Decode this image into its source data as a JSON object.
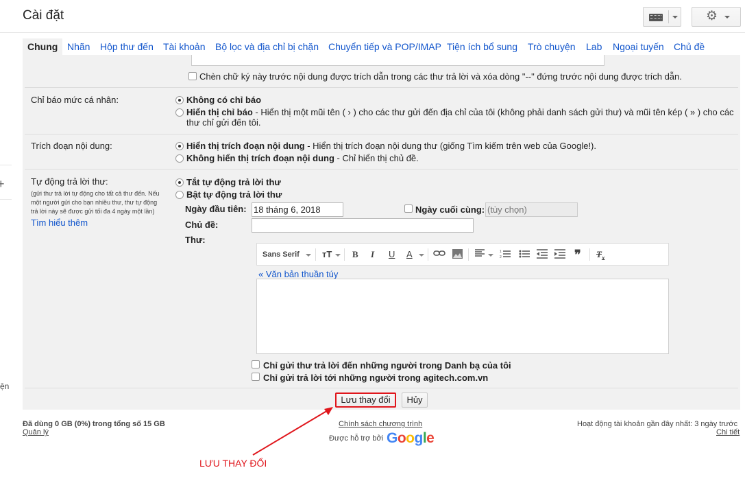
{
  "header": {
    "title": "Cài đặt"
  },
  "tabs": [
    {
      "label": "Chung"
    },
    {
      "label": "Nhãn"
    },
    {
      "label": "Hộp thư đến"
    },
    {
      "label": "Tài khoản"
    },
    {
      "label": "Bộ lọc và địa chỉ bị chặn"
    },
    {
      "label": "Chuyển tiếp và POP/IMAP"
    },
    {
      "label": "Tiện ích bổ sung"
    },
    {
      "label": "Trò chuyện"
    },
    {
      "label": "Lab"
    },
    {
      "label": "Ngoại tuyến"
    },
    {
      "label": "Chủ đề"
    }
  ],
  "signature_option": "Chèn chữ ký này trước nội dung được trích dẫn trong các thư trả lời và xóa dòng \"--\" đứng trước nội dung được trích dẫn.",
  "personal_indicators": {
    "label": "Chỉ báo mức cá nhân:",
    "option1": "Không có chỉ báo",
    "option2_title": "Hiển thị chỉ báo",
    "option2_desc": " - Hiển thị một mũi tên ( › ) cho các thư gửi đến địa chỉ của tôi (không phải danh sách gửi thư) và mũi tên kép ( » ) cho các",
    "option2_desc2": "thư chỉ gửi đến tôi."
  },
  "snippets": {
    "label": "Trích đoạn nội dung:",
    "option1_title": "Hiển thị trích đoạn nội dung",
    "option1_desc": " - Hiển thị trích đoạn nội dung thư (giống Tìm kiếm trên web của Google!).",
    "option2_title": "Không hiển thị trích đoạn nội dung",
    "option2_desc": " - Chỉ hiển thị chủ đề."
  },
  "vacation": {
    "label": "Tự động trả lời thư:",
    "note1": "(gửi thư trả lời tự động cho tất cả thư đến. Nếu",
    "note2": "một người gửi cho bạn nhiều thư, thư tự động",
    "note3": "trả lời này sẽ được gửi tối đa 4 ngày một lần)",
    "learn_more": "Tìm hiểu thêm",
    "off_label": "Tắt tự động trả lời thư",
    "on_label": "Bật tự động trả lời thư",
    "first_day_label": "Ngày đầu tiên:",
    "first_day_value": "18 tháng 6, 2018",
    "last_day_label": "Ngày cuối cùng:",
    "last_day_placeholder": "(tùy chọn)",
    "subject_label": "Chủ đề:",
    "subject_value": "",
    "message_label": "Thư:",
    "plain_text_link": "« Văn bản thuần túy",
    "contacts_only": "Chỉ gửi thư trả lời đến những người trong Danh bạ của tôi",
    "domain_only": "Chỉ gửi trả lời tới những người trong agitech.com.vn"
  },
  "editor_toolbar": {
    "font": "Sans Serif",
    "size_icon": "text-size-icon",
    "bold": "B",
    "italic": "I",
    "underline": "U",
    "text_color": "A"
  },
  "actions": {
    "save": "Lưu thay đổi",
    "cancel": "Hủy"
  },
  "footer": {
    "storage": "Đã dùng 0 GB (0%) trong tổng số 15 GB",
    "manage": "Quản lý",
    "policy": "Chính sách chương trình",
    "powered_by": "Được hỗ trợ bởi",
    "google": "Google",
    "activity": "Hoạt động tài khoản gần đây nhất: 3 ngày trước",
    "details": "Chi tiết"
  },
  "annotation": {
    "text": "LƯU THAY ĐỔI",
    "color": "#e0161c"
  },
  "edge_text": "ện",
  "colors": {
    "link": "#1155cc",
    "panel": "#f1f1f1",
    "highlight": "#e0161c"
  }
}
